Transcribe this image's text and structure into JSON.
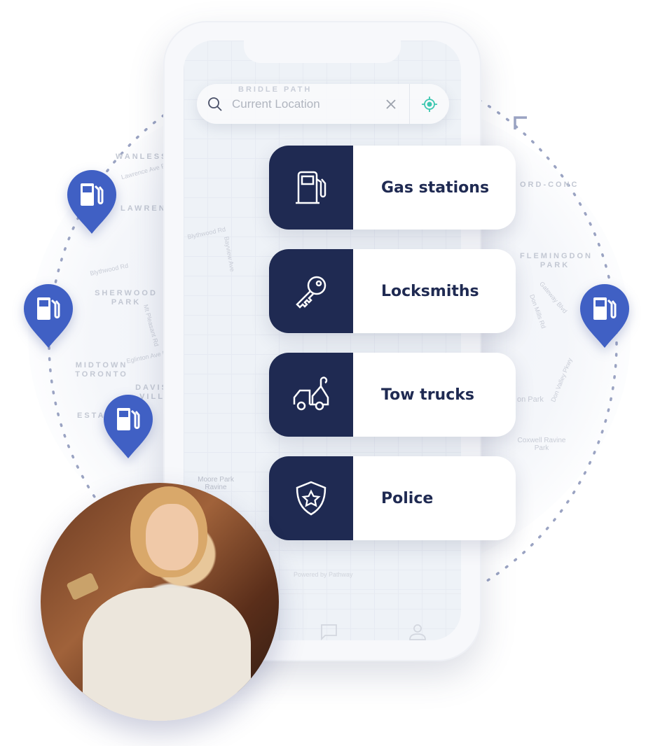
{
  "search": {
    "placeholder": "Current Location",
    "icon": "search-icon",
    "clear_icon": "close-icon",
    "locate_icon": "crosshair-icon"
  },
  "categories": [
    {
      "label": "Gas stations",
      "icon": "gas-pump-icon"
    },
    {
      "label": "Locksmiths",
      "icon": "key-icon"
    },
    {
      "label": "Tow trucks",
      "icon": "tow-truck-icon"
    },
    {
      "label": "Police",
      "icon": "police-shield-icon"
    }
  ],
  "footer": {
    "powered_by": "Powered by Pathway"
  },
  "map_labels": {
    "wanless": "WANLESS",
    "lawrence": "LAWREN",
    "park_rk": "RK",
    "sherwood": "SHERWOOD PARK",
    "midtown": "MIDTOWN TORONTO",
    "davisville": "DAVIS VILL",
    "estates": "ESTA",
    "flemingdon": "FLEMINGDON PARK",
    "concord": "ORD-CONC",
    "bridle": "BRIDLE PATH",
    "moore": "Moore Park Ravine",
    "coxwell": "Coxwell Ravine Park",
    "onpark": "on Park",
    "blythwood": "Blythwood Rd",
    "mtpleasant": "Mt Pleasant Rd",
    "eglinton": "Eglinton Ave E",
    "lawrenceave": "Lawrence Ave E",
    "bayview": "Bayview Ave",
    "donmills": "Don Mills Rd",
    "gateway": "Gateway Blvd",
    "dvp": "Don Valley Pkwy"
  },
  "colors": {
    "navy": "#1f2a52",
    "pin": "#4060c4",
    "accent": "#3cc7b0"
  }
}
